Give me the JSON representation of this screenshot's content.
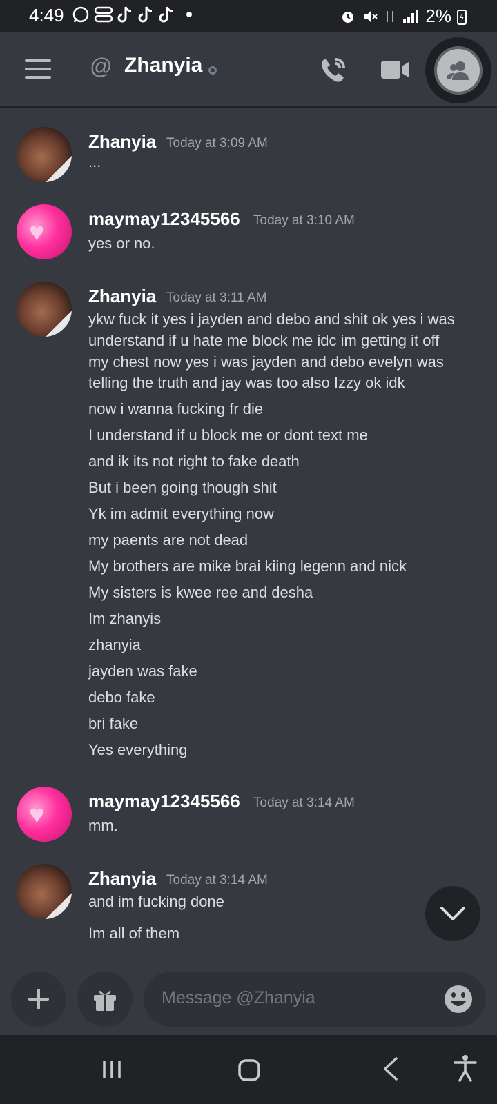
{
  "status_bar": {
    "time": "4:49",
    "battery": "2%"
  },
  "header": {
    "at_symbol": "@",
    "title": "Zhanyia"
  },
  "messages": [
    {
      "author": "Zhanyia",
      "timestamp": "Today at 3:09 AM",
      "avatar": "zhanyia-avatar",
      "lines": [
        "..."
      ]
    },
    {
      "author": "maymay12345566",
      "timestamp": "Today at 3:10 AM",
      "avatar": "maymay-avatar",
      "lines": [
        "yes or no."
      ]
    },
    {
      "author": "Zhanyia",
      "timestamp": "Today at 3:11 AM",
      "avatar": "zhanyia-avatar",
      "lines": [
        "ykw fuck it yes i jayden and debo and shit ok yes i was",
        "understand if u hate me block me idc im getting it off",
        "my chest now yes i was jayden and debo evelyn was",
        "telling the truth and jay was too also Izzy ok idk",
        "now i wanna fucking fr die",
        "I understand if u block me or dont text me",
        "and ik its not right to fake death",
        "But i been going though shit",
        "Yk im admit everything now",
        "my paents are not dead",
        "My brothers are mike brai kiing legenn and nick",
        "My sisters is kwee ree and desha",
        "Im zhanyis",
        "zhanyia",
        "jayden was fake",
        "debo fake",
        "bri fake",
        "Yes everything"
      ]
    },
    {
      "author": "maymay12345566",
      "timestamp": "Today at 3:14 AM",
      "avatar": "maymay-avatar",
      "lines": [
        "mm."
      ]
    },
    {
      "author": "Zhanyia",
      "timestamp": "Today at 3:14 AM",
      "avatar": "zhanyia-avatar",
      "lines": [
        "and im fucking done",
        "Im all of them"
      ]
    }
  ],
  "composer": {
    "placeholder": "Message @Zhanyia"
  },
  "colors": {
    "background": "#36393f",
    "dark": "#202225",
    "input": "#2f3136",
    "muted": "#72767d"
  }
}
